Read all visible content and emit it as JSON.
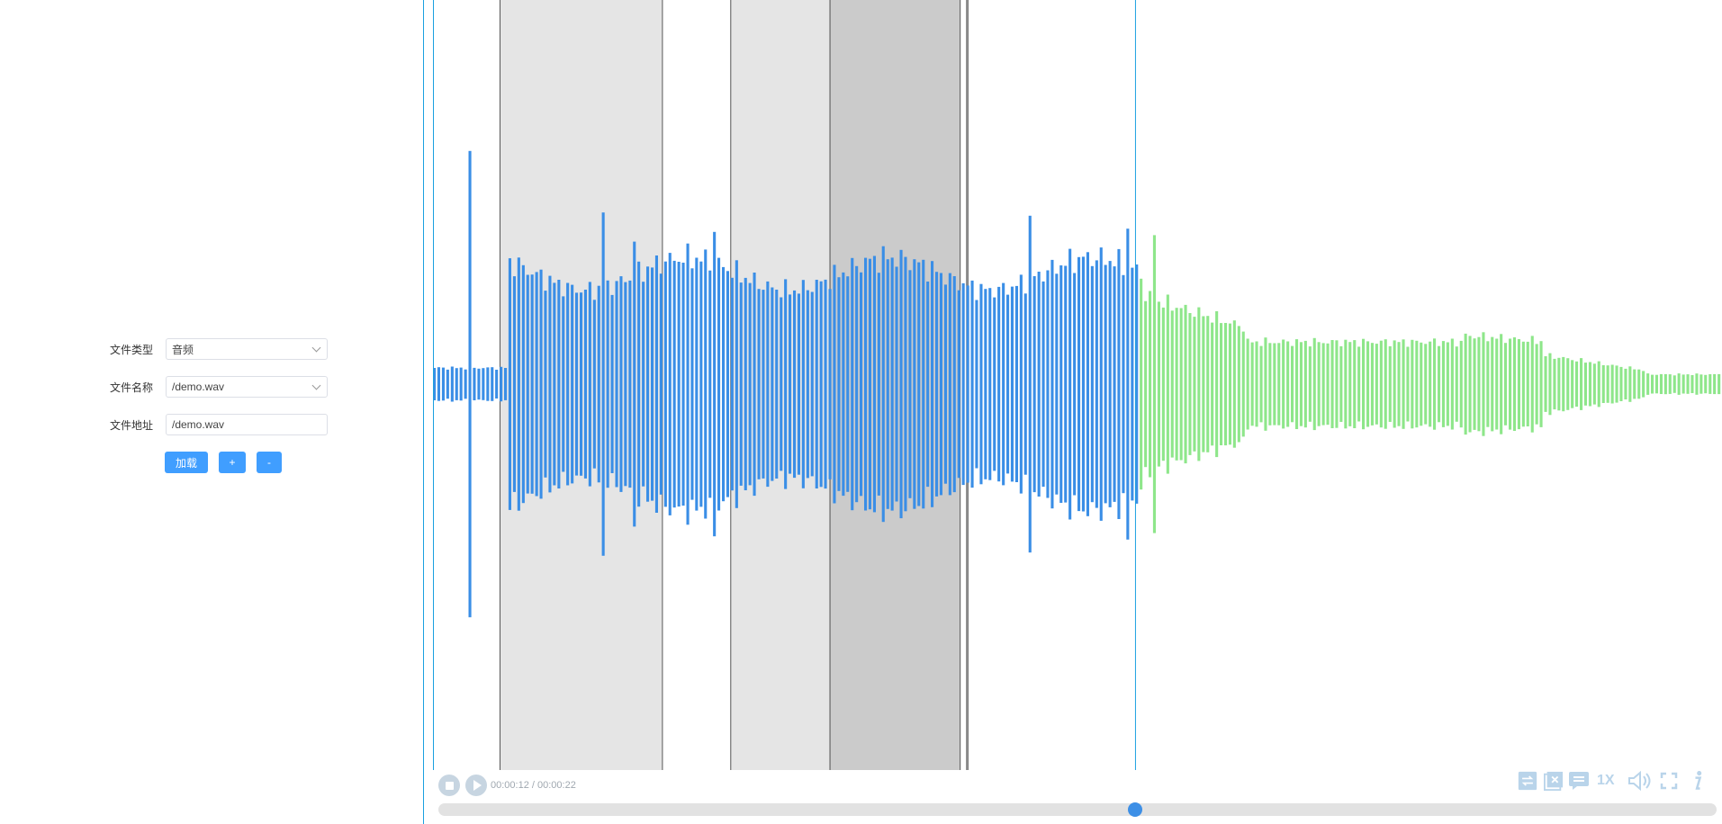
{
  "form": {
    "file_type": {
      "label": "文件类型",
      "value": "音频"
    },
    "file_name": {
      "label": "文件名称",
      "value": "/demo.wav"
    },
    "file_url": {
      "label": "文件地址",
      "value": "/demo.wav"
    },
    "load_label": "加载",
    "plus_label": "+",
    "minus_label": "-"
  },
  "player": {
    "time_text": "00:00:12 / 00:00:22",
    "played_fraction": 0.545,
    "speed_label": "1X",
    "played_color": "#3a8ee6",
    "unplayed_color": "#8ee68a",
    "cursor_color": "#1aa0e0",
    "region_color": "#e5e5e5",
    "region_selected_color": "#cbcbcb",
    "regions": [
      {
        "start": 0.052,
        "end": 0.178,
        "selected": false
      },
      {
        "start": 0.231,
        "end": 0.308,
        "selected": false
      },
      {
        "start": 0.308,
        "end": 0.409,
        "selected": true
      },
      {
        "start": 0.414,
        "end": 0.415,
        "selected": false
      }
    ],
    "icons": [
      "stop-icon",
      "play-icon",
      "loop-region-icon",
      "clear-regions-icon",
      "swap-icon",
      "volume-icon",
      "fullscreen-icon",
      "info-icon"
    ]
  }
}
